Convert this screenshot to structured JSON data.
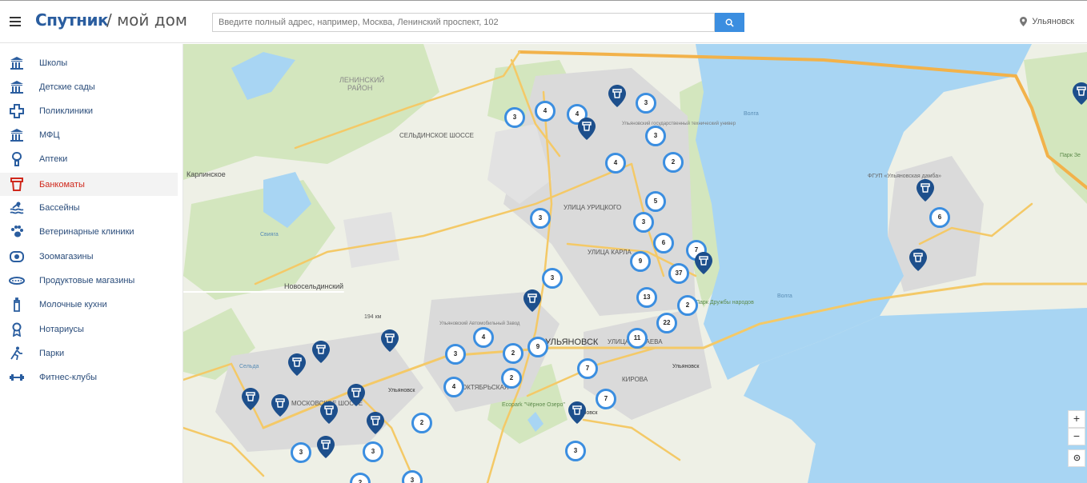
{
  "header": {
    "logo": "Спутник",
    "title": "/ мой дом",
    "search_placeholder": "Введите полный адрес, например, Москва, Ленинский проспект, 102",
    "city": "Ульяновск"
  },
  "sidebar": {
    "items": [
      {
        "label": "Школы",
        "icon": "school-icon",
        "active": false
      },
      {
        "label": "Детские сады",
        "icon": "kindergarten-icon",
        "active": false
      },
      {
        "label": "Поликлиники",
        "icon": "clinic-icon",
        "active": false
      },
      {
        "label": "МФЦ",
        "icon": "mfc-icon",
        "active": false
      },
      {
        "label": "Аптеки",
        "icon": "pharmacy-icon",
        "active": false
      },
      {
        "label": "Банкоматы",
        "icon": "atm-icon",
        "active": true
      },
      {
        "label": "Бассейны",
        "icon": "pool-icon",
        "active": false
      },
      {
        "label": "Ветеринарные клиники",
        "icon": "paw-icon",
        "active": false
      },
      {
        "label": "Зоомагазины",
        "icon": "pet-shop-icon",
        "active": false
      },
      {
        "label": "Продуктовые магазины",
        "icon": "grocery-icon",
        "active": false
      },
      {
        "label": "Молочные кухни",
        "icon": "baby-bottle-icon",
        "active": false
      },
      {
        "label": "Нотариусы",
        "icon": "notary-icon",
        "active": false
      },
      {
        "label": "Парки",
        "icon": "park-icon",
        "active": false
      },
      {
        "label": "Фитнес-клубы",
        "icon": "dumbbell-icon",
        "active": false
      }
    ]
  },
  "map": {
    "labels": {
      "lenin_district": "ЛЕНИНСКИЙ",
      "lenin_district_2": "РАЙОН",
      "karlinskoe": "Карлинское",
      "novoselda": "Новосельдинский",
      "seldinskoe": "СЕЛЬДИНСКОЕ ШОССЕ",
      "moskovskoe": "МОСКОВСКОЕ ШОССЕ",
      "oktyabrskaya": "ОКТЯБРЬСКАЯ",
      "urickogo": "УЛИЦА УРИЦКОГО",
      "karla": "УЛИЦА КАРЛА",
      "minaeva": "УЛИЦА МИНАЕВА",
      "kirova": "КИРОВА",
      "city_big": "УЛЬЯНОВСК",
      "university": "Ульяновский государственный технический универ",
      "auto_plant": "Ульяновский Автомобильный Завод",
      "park": "Ecopark \"Чёрное Озеро\"",
      "park_druzhby": "Парк Дружбы народов",
      "fgup": "ФГУП «Ульяновская дамба»",
      "volga1": "Волга",
      "volga2": "Волга",
      "km194": "194 км",
      "sviyaga": "Свияга",
      "selda": "Сельда",
      "ulyanovsk_small_1": "Ульяновск",
      "ulyanovsk_small_2": "Ульяновск",
      "ulyanovsk_small_3": "Ульяновск",
      "park_ne": "Парк Зе"
    },
    "clusters": [
      {
        "n": "3"
      },
      {
        "n": "4"
      },
      {
        "n": "4"
      },
      {
        "n": "3"
      },
      {
        "n": "3"
      },
      {
        "n": "4"
      },
      {
        "n": "2"
      },
      {
        "n": "5"
      },
      {
        "n": "3"
      },
      {
        "n": "3"
      },
      {
        "n": "6"
      },
      {
        "n": "7"
      },
      {
        "n": "9"
      },
      {
        "n": "37"
      },
      {
        "n": "3"
      },
      {
        "n": "13"
      },
      {
        "n": "2"
      },
      {
        "n": "22"
      },
      {
        "n": "11"
      },
      {
        "n": "4"
      },
      {
        "n": "9"
      },
      {
        "n": "2"
      },
      {
        "n": "3"
      },
      {
        "n": "2"
      },
      {
        "n": "7"
      },
      {
        "n": "4"
      },
      {
        "n": "7"
      },
      {
        "n": "2"
      },
      {
        "n": "3"
      },
      {
        "n": "3"
      },
      {
        "n": "3"
      },
      {
        "n": "2"
      },
      {
        "n": "3"
      },
      {
        "n": "6"
      }
    ],
    "pin_color": "#1d4f8c",
    "cluster_color": "#3b8ee0"
  },
  "controls": {
    "zoom_in": "+",
    "zoom_out": "−"
  }
}
